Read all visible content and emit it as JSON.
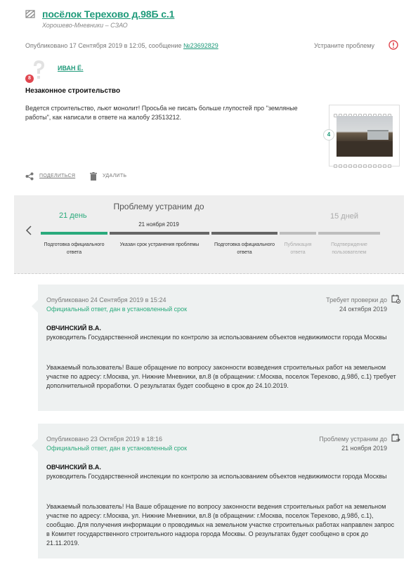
{
  "header": {
    "address": "посёлок Терехово д.98Б с.1",
    "district": "Хорошево-Мневники – СЗАО",
    "published_prefix": "Опубликовано 17 Сентября 2019 в 12:05, сообщение ",
    "message_number": "№23692829",
    "fix_problem_label": "Устраните проблему"
  },
  "author": {
    "name": "ИВАН Ё.",
    "badge": "8"
  },
  "problem": {
    "title": "Незаконное строительство",
    "text": "Ведется строительство, льют монолит! Просьба не писать больше глупостей про \"земляные работы\", как написали в ответе на жалобу 23513212.",
    "photo_count": "4"
  },
  "actions": {
    "share_label": "ПОДЕЛИТЬСЯ",
    "delete_label": "УДАЛИТЬ"
  },
  "timeline": {
    "day_start": "21 день",
    "center_title": "Проблему устраним до",
    "center_date": "21 ноября 2019",
    "day_end": "15 дней",
    "steps": [
      {
        "label": "Подготовка официального ответа"
      },
      {
        "label": "Указан срок устранения проблемы"
      },
      {
        "label": "Подготовка официального ответа"
      },
      {
        "label": "Публикация ответа"
      },
      {
        "label": "Подтверждение пользователем"
      }
    ]
  },
  "answers": [
    {
      "published": "Опубликовано 24 Сентября 2019 в 15:24",
      "status": "Официальный ответ, дан в установленный срок",
      "right_label": "Требует проверки до",
      "right_date": "24 октября 2019",
      "author": "ОВЧИНСКИЙ В.А.",
      "role": "руководитель Государственной инспекции по контролю за использованием объектов недвижимости города Москвы",
      "body": "Уважаемый пользователь! Ваше обращение по вопросу законности возведения строительных работ на земельном участке по адресу: г.Москва, ул. Нижние Мневники, вл.8 (в обращении: г.Москва, поселок Терехово, д.98б, с.1) требует дополнительной проработки. О результатах будет сообщено в срок до 24.10.2019."
    },
    {
      "published": "Опубликовано 23 Октября 2019 в 18:16",
      "status": "Официальный ответ, дан в установленный срок",
      "right_label": "Проблему устраним до",
      "right_date": "21 ноября 2019",
      "author": "ОВЧИНСКИЙ В.А.",
      "role": "руководитель Государственной инспекции по контролю за использованием объектов недвижимости города Москвы",
      "body": "Уважаемый пользователь! На Ваше обращение по вопросу законности ведения строительных работ на земельном участке по адресу: г.Москва, ул. Нижние Мневники, вл.8 (в обращении: г.Москва, поселок Терехово, д.98б, с.1), сообщаю. Для получения информации о проводимых на земельном участке строительных работах направлен запрос в Комитет государственного строительного надзора города Москвы. О результатах будет сообщено в срок до 21.11.2019."
    }
  ],
  "colors": {
    "accent": "#1f9a7a",
    "green": "#2aaa7c",
    "warning": "#e0464f",
    "panel": "#eef1f1"
  }
}
